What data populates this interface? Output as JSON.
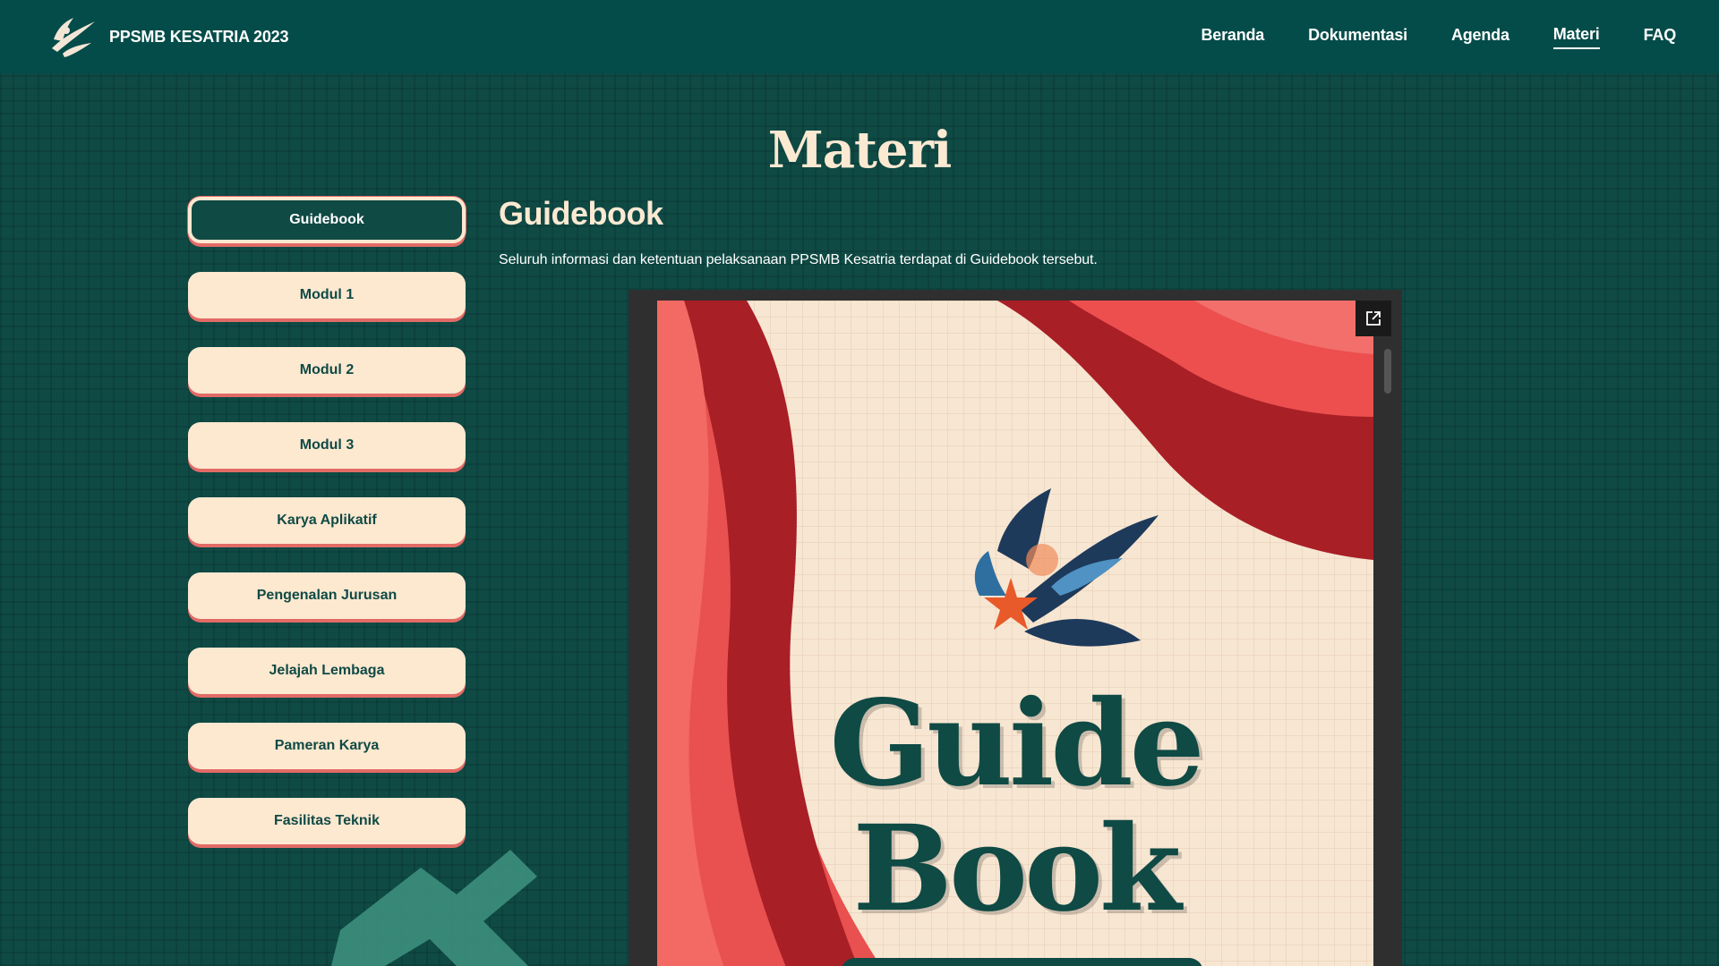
{
  "header": {
    "brand": "PPSMB KESATRIA 2023",
    "nav": [
      {
        "label": "Beranda"
      },
      {
        "label": "Dokumentasi"
      },
      {
        "label": "Agenda"
      },
      {
        "label": "Materi"
      },
      {
        "label": "FAQ"
      }
    ],
    "active_nav": "Materi"
  },
  "page": {
    "title": "Materi"
  },
  "sidebar": {
    "items": [
      {
        "label": "Guidebook"
      },
      {
        "label": "Modul 1"
      },
      {
        "label": "Modul 2"
      },
      {
        "label": "Modul 3"
      },
      {
        "label": "Karya Aplikatif"
      },
      {
        "label": "Pengenalan Jurusan"
      },
      {
        "label": "Jelajah Lembaga"
      },
      {
        "label": "Pameran Karya"
      },
      {
        "label": "Fasilitas Teknik"
      }
    ],
    "active": "Guidebook"
  },
  "content": {
    "title": "Guidebook",
    "description": "Seluruh informasi dan ketentuan pelaksanaan PPSMB Kesatria terdapat di Guidebook tersebut."
  },
  "document": {
    "cover_line1": "Guide",
    "cover_line2": "Book"
  },
  "colors": {
    "background": "#0f4a45",
    "header": "#044c49",
    "cream": "#fde8d0",
    "accent_red": "#e26b66"
  }
}
